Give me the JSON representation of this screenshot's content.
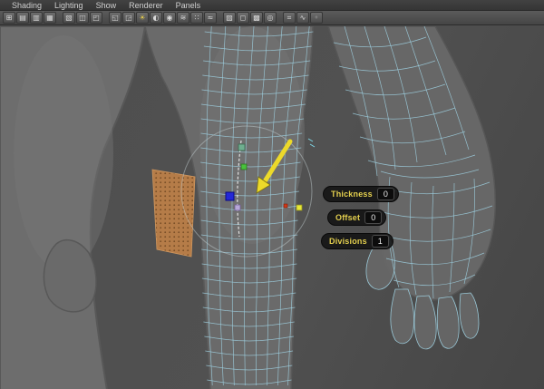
{
  "panel_menu": {
    "items": [
      {
        "label": "Shading"
      },
      {
        "label": "Lighting"
      },
      {
        "label": "Show"
      },
      {
        "label": "Renderer"
      },
      {
        "label": "Panels"
      }
    ]
  },
  "toolbar": {
    "icons": [
      {
        "name": "grid-icon",
        "glyph": "⊞"
      },
      {
        "name": "film-gate-icon",
        "glyph": "▤"
      },
      {
        "name": "resolution-gate-icon",
        "glyph": "▥"
      },
      {
        "name": "gate-mask-icon",
        "glyph": "▦"
      },
      {
        "name": "field-chart-icon",
        "glyph": "▧"
      },
      {
        "name": "safe-action-icon",
        "glyph": "◫"
      },
      {
        "name": "safe-title-icon",
        "glyph": "◰"
      },
      {
        "name": "frame-all-icon",
        "glyph": "◱"
      },
      {
        "name": "frame-selection-icon",
        "glyph": "◲"
      },
      {
        "name": "lighting-icon",
        "glyph": "☀"
      },
      {
        "name": "shadows-icon",
        "glyph": "◐"
      },
      {
        "name": "ambient-occlusion-icon",
        "glyph": "◉"
      },
      {
        "name": "motion-blur-icon",
        "glyph": "≋"
      },
      {
        "name": "multisample-icon",
        "glyph": "∷"
      },
      {
        "name": "fog-icon",
        "glyph": "≈"
      },
      {
        "name": "xray-icon",
        "glyph": "▨"
      },
      {
        "name": "wireframe-on-shaded-icon",
        "glyph": "◻"
      },
      {
        "name": "textured-icon",
        "glyph": "▩"
      },
      {
        "name": "isolate-select-icon",
        "glyph": "◎"
      },
      {
        "name": "snap-grid-icon",
        "glyph": "⌗"
      },
      {
        "name": "snap-curve-icon",
        "glyph": "∿"
      },
      {
        "name": "snap-point-icon",
        "glyph": "◦"
      }
    ]
  },
  "viewport": {
    "hud_fields": [
      {
        "label": "Thickness",
        "value": "0"
      },
      {
        "label": "Offset",
        "value": "0"
      },
      {
        "label": "Divisions",
        "value": "1"
      }
    ],
    "colors": {
      "wireframe": "#9ecfdf",
      "annotation_arrow": "#ecd92a",
      "selection_patch": "#c08148",
      "hud_label": "#e3cf4e",
      "manipulator_blue": "#2428d8",
      "manipulator_green": "#49c23c",
      "manipulator_yellow": "#e8e838"
    }
  }
}
